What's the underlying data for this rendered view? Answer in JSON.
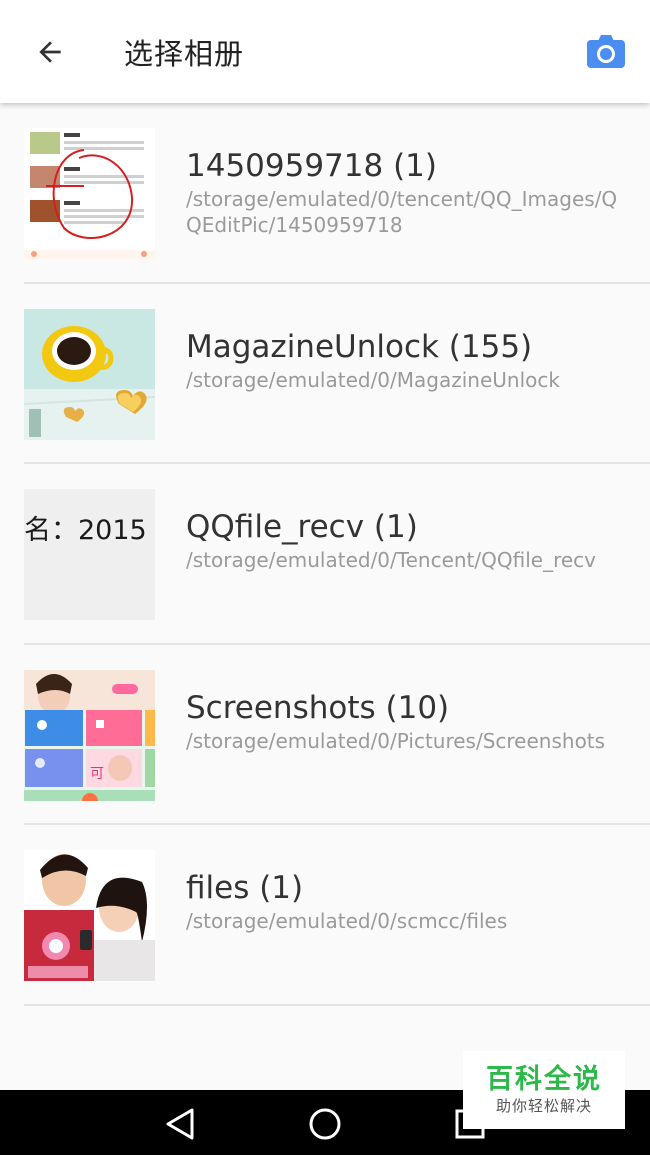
{
  "header": {
    "title": "选择相册",
    "back_icon": "arrow-left-icon",
    "camera_icon": "camera-icon",
    "accent_color": "#4285f4"
  },
  "albums": [
    {
      "name": "1450959718 (1)",
      "path": "/storage/emulated/0/tencent/QQ_Images/QQEditPic/1450959718",
      "thumbnail": "recipe-list-screenshot"
    },
    {
      "name": "MagazineUnlock (155)",
      "path": "/storage/emulated/0/MagazineUnlock",
      "thumbnail": "coffee-cup-photo"
    },
    {
      "name": "QQfile_recv (1)",
      "path": "/storage/emulated/0/Tencent/QQfile_recv",
      "thumbnail": "text-snippet",
      "thumbnail_text": "名：2015"
    },
    {
      "name": "Screenshots (10)",
      "path": "/storage/emulated/0/Pictures/Screenshots",
      "thumbnail": "app-screenshot"
    },
    {
      "name": "files (1)",
      "path": "/storage/emulated/0/scmcc/files",
      "thumbnail": "couple-photo"
    }
  ],
  "nav": {
    "back_icon": "triangle-back-icon",
    "home_icon": "circle-home-icon",
    "recents_icon": "square-recents-icon"
  },
  "watermark": {
    "title": "百科全说",
    "subtitle": "助你轻松解决"
  }
}
